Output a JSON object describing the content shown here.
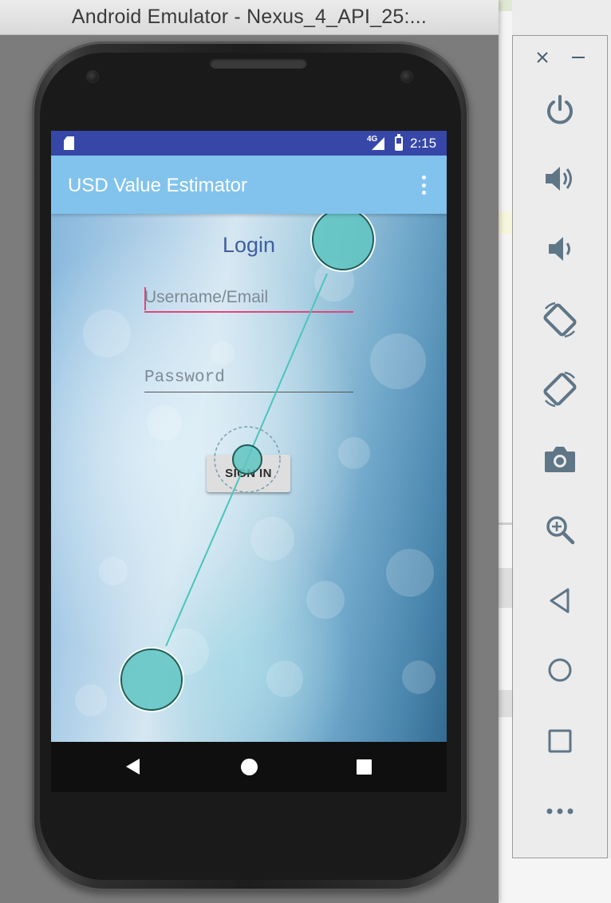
{
  "window": {
    "title": "Android Emulator - Nexus_4_API_25:..."
  },
  "statusbar": {
    "network": "4G",
    "time": "2:15"
  },
  "app": {
    "title": "USD Value Estimator",
    "menu_icon": "overflow-menu-icon"
  },
  "login": {
    "heading": "Login",
    "username_placeholder": "Username/Email",
    "password_placeholder": "Password",
    "signin_label": "SIGN IN"
  },
  "navbar": {
    "back_icon": "back-triangle-icon",
    "home_icon": "home-circle-icon",
    "recents_icon": "recents-square-icon"
  },
  "toolbar": {
    "close_icon": "close-icon",
    "minimize_icon": "minimize-icon",
    "items": [
      "power-icon",
      "volume-up-icon",
      "volume-down-icon",
      "rotate-left-icon",
      "rotate-right-icon",
      "camera-icon",
      "zoom-icon",
      "back-icon",
      "home-icon",
      "overview-icon",
      "more-icon"
    ]
  },
  "colors": {
    "statusbar": "#3647a8",
    "appbar": "#82c3ee",
    "accent": "#e2457c",
    "touch_point": "#5fc5c2",
    "toolbar_icon": "#5f7687"
  }
}
